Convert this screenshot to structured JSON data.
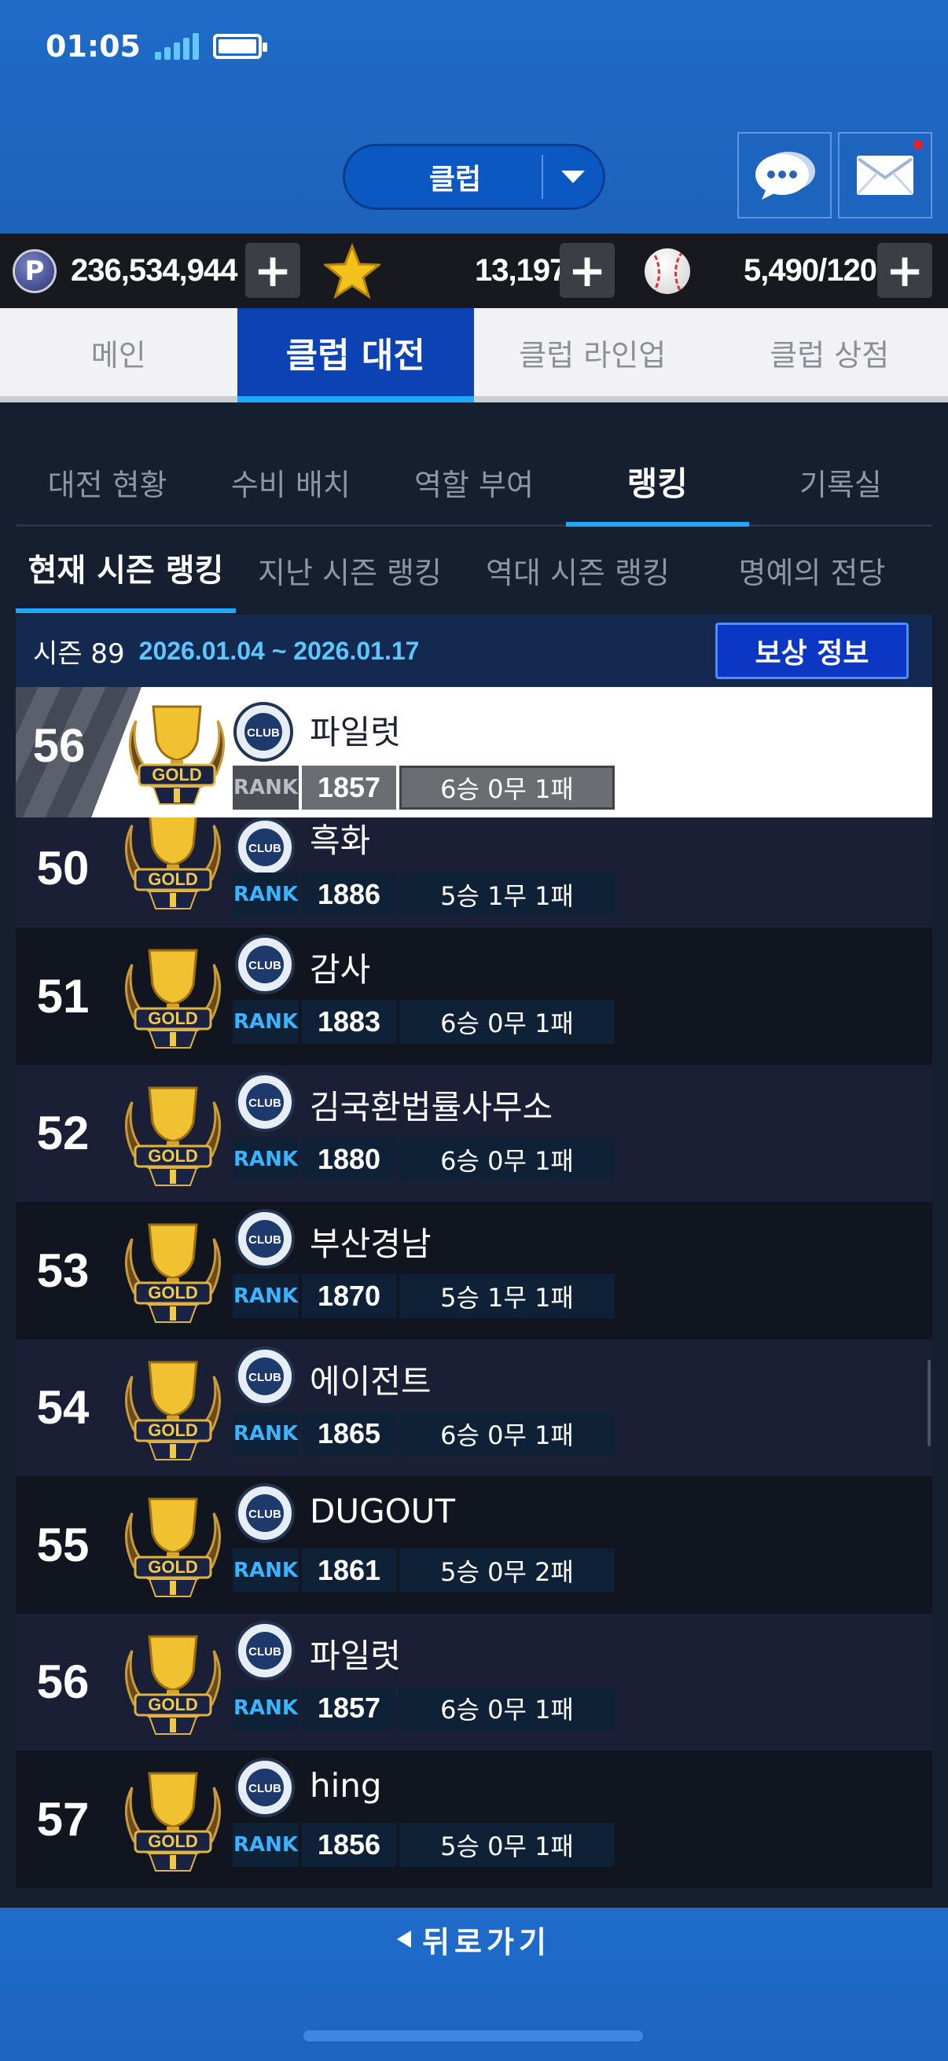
{
  "status_bar": {
    "time": "01:05"
  },
  "header": {
    "club_select_label": "클럽"
  },
  "currency": {
    "points": "236,534,944",
    "stars": "13,197",
    "balls": "5,490/120",
    "plus_label": "+"
  },
  "main_tabs": [
    {
      "label": "메인",
      "active": false
    },
    {
      "label": "클럽 대전",
      "active": true
    },
    {
      "label": "클럽 라인업",
      "active": false
    },
    {
      "label": "클럽 상점",
      "active": false
    }
  ],
  "sub_tabs": [
    {
      "label": "대전 현황"
    },
    {
      "label": "수비 배치"
    },
    {
      "label": "역할 부여"
    },
    {
      "label": "랭킹"
    },
    {
      "label": "기록실"
    }
  ],
  "ranking_tabs": [
    {
      "label": "현재 시즌 랭킹"
    },
    {
      "label": "지난 시즌 랭킹"
    },
    {
      "label": "역대 시즌 랭킹"
    },
    {
      "label": "명예의 전당"
    }
  ],
  "season": {
    "label": "시즌 89",
    "dates": "2026.01.04 ~ 2026.01.17",
    "reward_button": "보상 정보"
  },
  "rank_label": "RANK",
  "my_club": {
    "position": "56",
    "name": "파일럿",
    "rating": "1857",
    "record": "6승 0무 1패"
  },
  "rows": [
    {
      "position": "50",
      "name": "흑화",
      "rating": "1886",
      "record": "5승 1무 1패"
    },
    {
      "position": "51",
      "name": "감사",
      "rating": "1883",
      "record": "6승 0무 1패"
    },
    {
      "position": "52",
      "name": "김국환법률사무소",
      "rating": "1880",
      "record": "6승 0무 1패"
    },
    {
      "position": "53",
      "name": "부산경남",
      "rating": "1870",
      "record": "5승 1무 1패"
    },
    {
      "position": "54",
      "name": "에이전트",
      "rating": "1865",
      "record": "6승 0무 1패"
    },
    {
      "position": "55",
      "name": "DUGOUT",
      "rating": "1861",
      "record": "5승 0무 2패"
    },
    {
      "position": "56",
      "name": "파일럿",
      "rating": "1857",
      "record": "6승 0무 1패"
    },
    {
      "position": "57",
      "name": "hing",
      "rating": "1856",
      "record": "5승 0무 1패"
    }
  ],
  "footer": {
    "back_label": "뒤로가기"
  },
  "colors": {
    "accent": "#20a7ff",
    "header_blue": "#1f6bc7",
    "tab_active": "#0d42b5"
  }
}
